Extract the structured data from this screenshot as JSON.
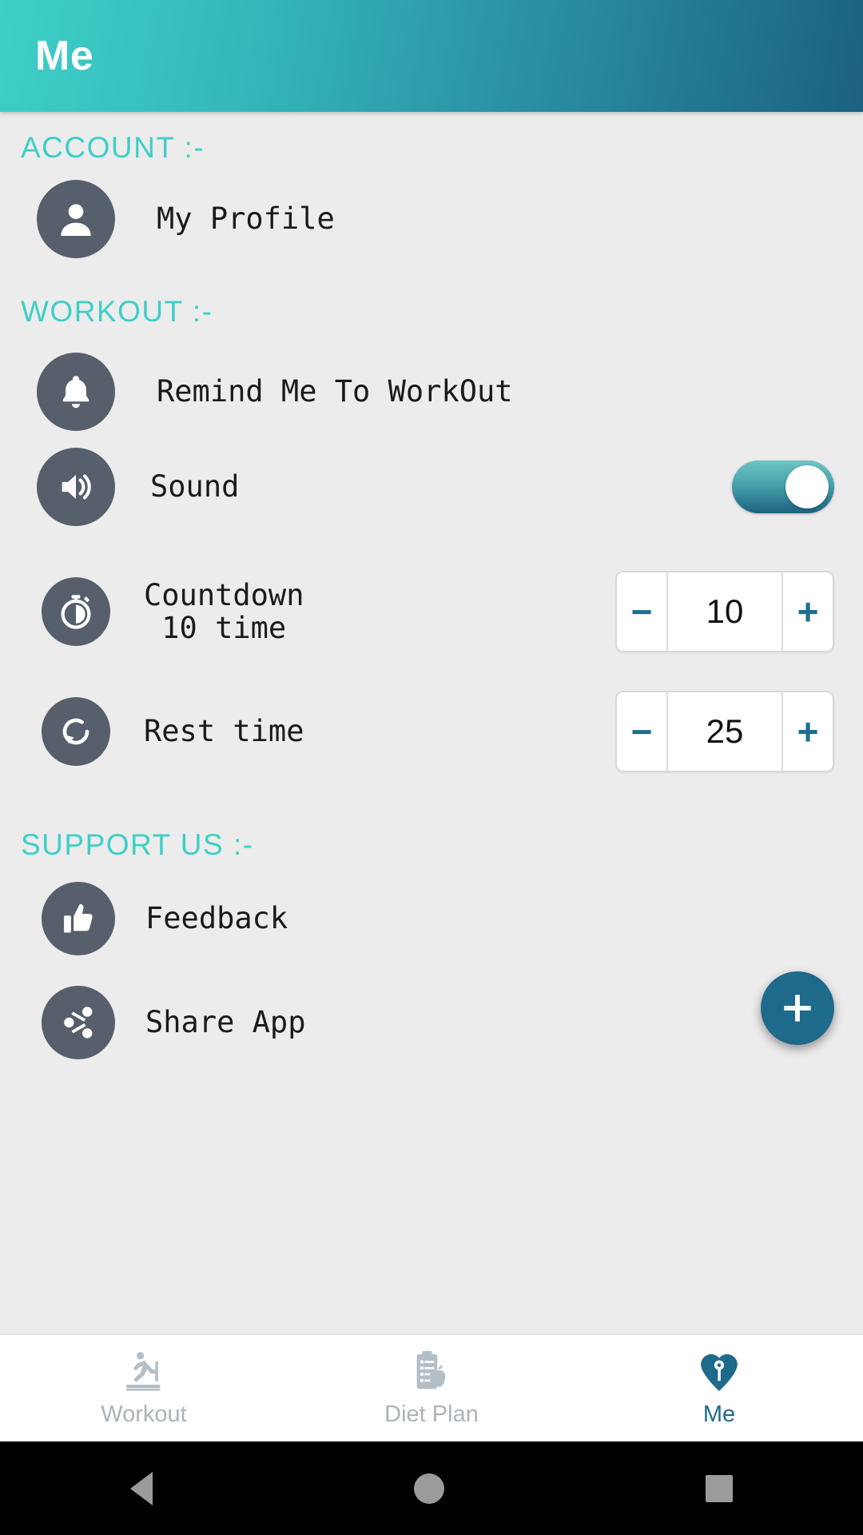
{
  "appbar": {
    "title": "Me"
  },
  "sections": {
    "account": {
      "title": "ACCOUNT  :-"
    },
    "workout": {
      "title": "WORKOUT  :-"
    },
    "support": {
      "title": "SUPPORT US  :-"
    }
  },
  "rows": {
    "profile": {
      "label": "My Profile",
      "icon": "person-icon"
    },
    "remind": {
      "label": "Remind Me To WorkOut",
      "icon": "bell-icon"
    },
    "sound": {
      "label": "Sound",
      "icon": "volume-icon",
      "toggle_on": true
    },
    "countdown": {
      "label_line1": "Countdown",
      "label_line2": "10 time",
      "icon": "stopwatch-icon"
    },
    "rest": {
      "label": "Rest time",
      "icon": "restore-icon"
    },
    "feedback": {
      "label": "Feedback",
      "icon": "thumbs-up-icon"
    },
    "share": {
      "label": "Share App",
      "icon": "share-icon"
    }
  },
  "steppers": {
    "countdown": {
      "minus": "−",
      "value": "10",
      "plus": "+"
    },
    "rest": {
      "minus": "−",
      "value": "25",
      "plus": "+"
    }
  },
  "fab": {
    "icon": "plus-icon"
  },
  "bottom_nav": {
    "items": [
      {
        "label": "Workout",
        "icon": "treadmill-icon",
        "active": false
      },
      {
        "label": "Diet Plan",
        "icon": "clipboard-apple-icon",
        "active": false
      },
      {
        "label": "Me",
        "icon": "heart-person-icon",
        "active": true
      }
    ]
  },
  "system_nav": {
    "back": "back-triangle-icon",
    "home": "home-circle-icon",
    "recents": "recents-square-icon"
  },
  "colors": {
    "accent_teal": "#3fcfc7",
    "accent_deep": "#1d6a8a",
    "icon_circle": "#565f6b",
    "page_bg": "#ececec",
    "stepper_sign": "#1d6f8e"
  }
}
